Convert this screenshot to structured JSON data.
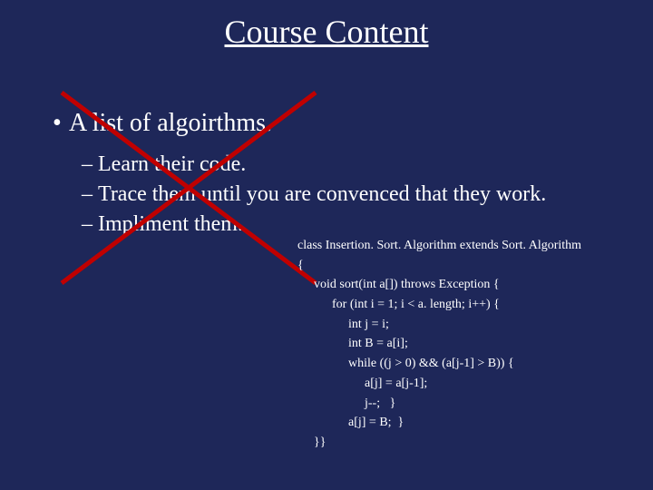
{
  "title": "Course Content",
  "bullets": {
    "main": "A list of algoirthms.",
    "sub1": "Learn their code.",
    "sub2": "Trace them until you are convenced that they work.",
    "sub3": "Impliment them."
  },
  "code": {
    "l1": "class Insertion. Sort. Algorithm extends Sort. Algorithm",
    "l2": "{",
    "l3": "void sort(int a[]) throws Exception {",
    "l4": "for (int i = 1; i < a. length; i++) {",
    "l5": "int j = i;",
    "l6": "int B = a[i];",
    "l7": "while ((j > 0) && (a[j-1] > B)) {",
    "l8": "a[j] = a[j-1];",
    "l9": "j--;   }",
    "l10": "a[j] = B;  }",
    "l11": "}}"
  }
}
